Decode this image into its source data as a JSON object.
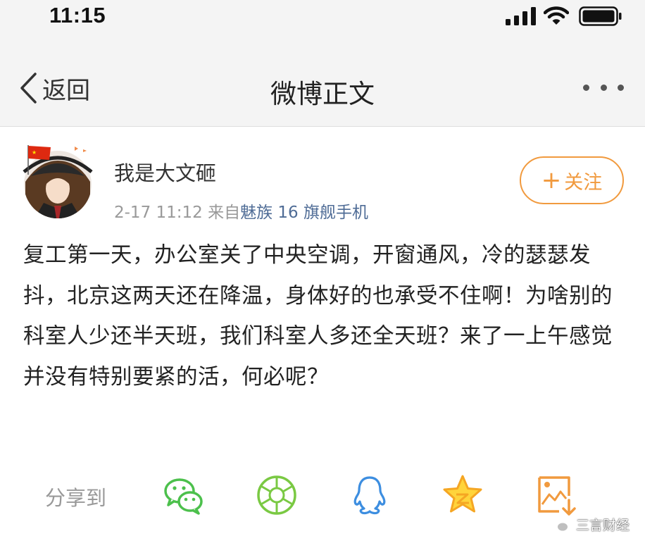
{
  "status_bar": {
    "time": "11:15",
    "icons": [
      "signal-icon",
      "wifi-icon",
      "battery-icon"
    ]
  },
  "nav": {
    "back_label": "返回",
    "title": "微博正文",
    "more_icon": "more-icon"
  },
  "post": {
    "author": "我是大文砸",
    "date_time": "2-17 11:12",
    "source_prefix": "来自",
    "source": "魅族 16 旗舰手机",
    "follow_label": "关注",
    "body": "复工第一天，办公室关了中央空调，开窗通风，冷的瑟瑟发抖，北京这两天还在降温，身体好的也承受不住啊！为啥别的科室人少还半天班，我们科室人多还全天班？来了一上午感觉并没有特别要紧的活，何必呢？"
  },
  "share": {
    "label": "分享到",
    "targets": [
      "wechat-icon",
      "moments-icon",
      "qq-icon",
      "qzone-icon",
      "save-image-icon"
    ]
  },
  "watermark": {
    "text": "三言财经"
  },
  "colors": {
    "accent": "#f19a3e",
    "green": "#4cc04c",
    "qq_blue": "#3d8ee0",
    "source_link": "#4f6c96",
    "nav_bg": "#f4f4f4"
  }
}
